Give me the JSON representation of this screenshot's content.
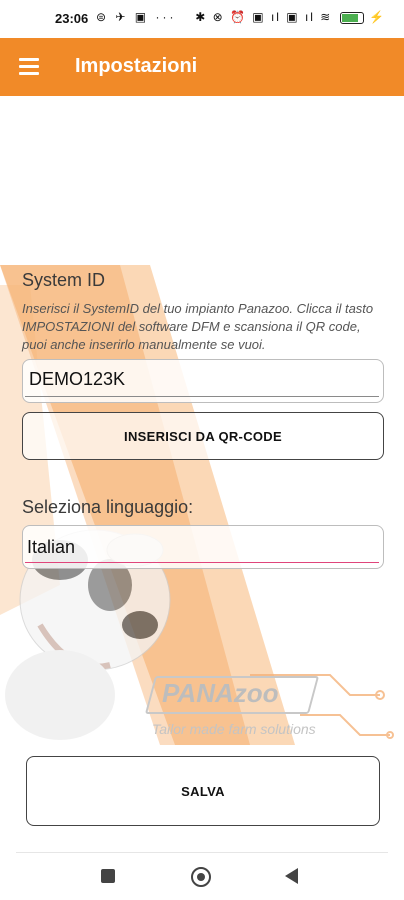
{
  "status_bar": {
    "time": "23:06",
    "left_icons": "⊜ ✈ ▣ ···",
    "right_icons": "✱ ⊗ ⏰ ▣ ıl ▣ ıl ≋",
    "battery_level": 0.85
  },
  "app_bar": {
    "title": "Impostazioni",
    "background_color": "#f18a28"
  },
  "form": {
    "system_id_label": "System ID",
    "system_id_help": "Inserisci il SystemID del tuo impianto Panazoo. Clicca il tasto IMPOSTAZIONI del software DFM e scansiona il QR code, puoi anche inserirlo manualmente se vuoi.",
    "system_id_value": "DEMO123K",
    "qr_button_label": "INSERISCI DA QR-CODE",
    "language_label": "Seleziona linguaggio:",
    "language_value": "Italian",
    "save_button_label": "SALVA"
  },
  "branding": {
    "logo_text": "PANAzoo",
    "tagline": "Tailor made farm solutions",
    "accent_color": "#f18a28"
  },
  "nav_bar": {
    "icons": [
      "square-recents-icon",
      "circle-home-icon",
      "triangle-back-icon"
    ]
  }
}
